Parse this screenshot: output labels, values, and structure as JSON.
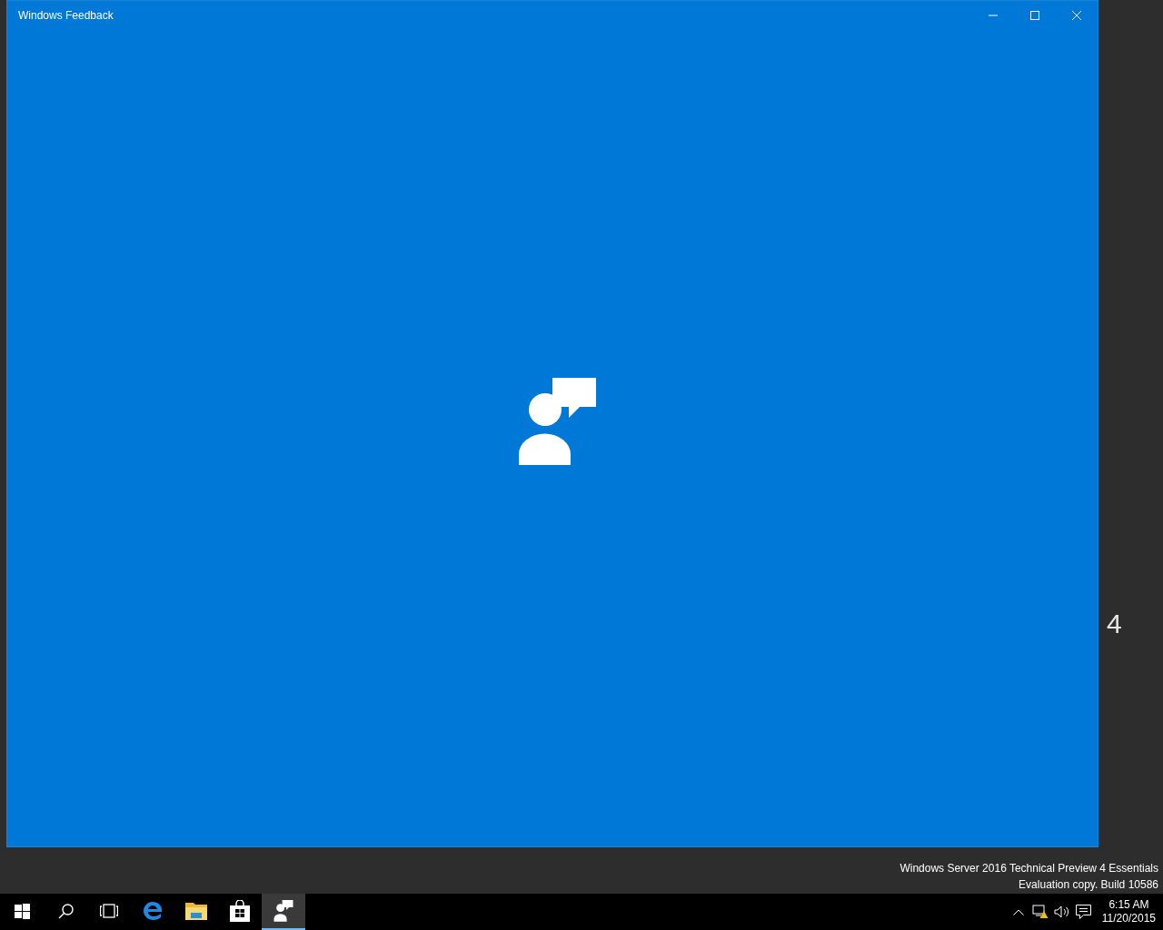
{
  "window": {
    "title": "Windows Feedback"
  },
  "desktop": {
    "wallpaper_fragment": "4",
    "watermark_lines": [
      "Windows Server 2016 Technical Preview 4 Essentials",
      "Evaluation copy. Build 10586"
    ]
  },
  "taskbar": {
    "buttons": [
      {
        "kind": "start"
      },
      {
        "kind": "search"
      },
      {
        "kind": "taskview"
      }
    ],
    "apps": [
      {
        "kind": "edge",
        "selected": false
      },
      {
        "kind": "explorer",
        "selected": false
      },
      {
        "kind": "store",
        "selected": false
      },
      {
        "kind": "feedback",
        "selected": true
      }
    ],
    "clock": {
      "time": "6:15 AM",
      "date": "11/20/2015"
    }
  }
}
